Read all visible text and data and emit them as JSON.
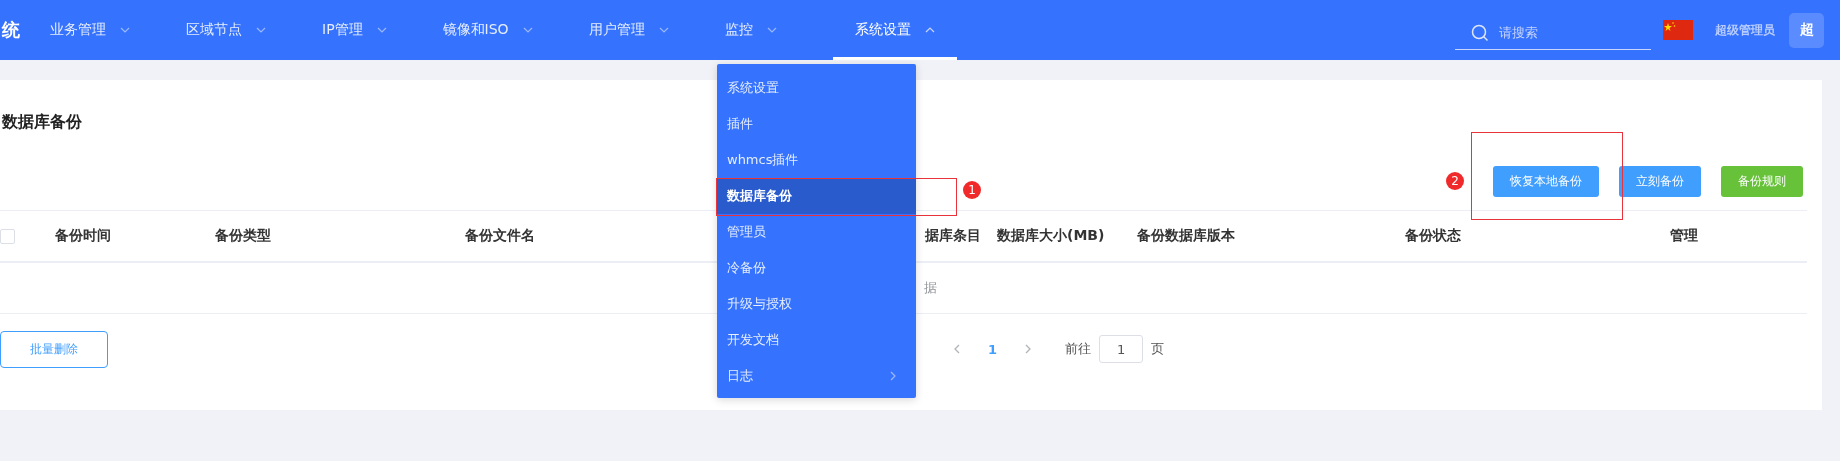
{
  "header": {
    "logo": "统",
    "nav": [
      {
        "label": "业务管理",
        "selected": false
      },
      {
        "label": "区域节点",
        "selected": false
      },
      {
        "label": "IP管理",
        "selected": false
      },
      {
        "label": "镜像和ISO",
        "selected": false
      },
      {
        "label": "用户管理",
        "selected": false
      },
      {
        "label": "监控",
        "selected": false
      },
      {
        "label": "系统设置",
        "selected": true
      }
    ],
    "search": {
      "placeholder": "请搜索"
    },
    "user": {
      "role": "超级管理员",
      "avatar": "超"
    }
  },
  "dropdown": {
    "items": [
      {
        "label": "系统设置",
        "selected": false,
        "has_submenu": false
      },
      {
        "label": "插件",
        "selected": false,
        "has_submenu": false
      },
      {
        "label": "whmcs插件",
        "selected": false,
        "has_submenu": false
      },
      {
        "label": "数据库备份",
        "selected": true,
        "has_submenu": false
      },
      {
        "label": "管理员",
        "selected": false,
        "has_submenu": false
      },
      {
        "label": "冷备份",
        "selected": false,
        "has_submenu": false
      },
      {
        "label": "升级与授权",
        "selected": false,
        "has_submenu": false
      },
      {
        "label": "开发文档",
        "selected": false,
        "has_submenu": false
      },
      {
        "label": "日志",
        "selected": false,
        "has_submenu": true
      }
    ]
  },
  "page": {
    "title": "数据库备份",
    "buttons": [
      {
        "label": "恢复本地备份",
        "kind": "primary"
      },
      {
        "label": "立刻备份",
        "kind": "primary"
      },
      {
        "label": "备份规则",
        "kind": "success"
      }
    ],
    "table": {
      "select_all": {
        "checked": false
      },
      "columns": [
        "备份时间",
        "备份类型",
        "备份文件名",
        "据库条目",
        "数据库大小(MB)",
        "备份数据库版本",
        "备份状态",
        "管理"
      ],
      "empty_text": "据"
    },
    "bulk_delete": "批量删除",
    "pagination": {
      "pages": [
        {
          "label": "1",
          "selected": true
        }
      ],
      "goto_label": "前往",
      "goto_value": "1",
      "page_unit": "页"
    }
  },
  "annotations": [
    {
      "label": "1",
      "kind": "menu"
    },
    {
      "label": "2",
      "kind": "button"
    }
  ]
}
